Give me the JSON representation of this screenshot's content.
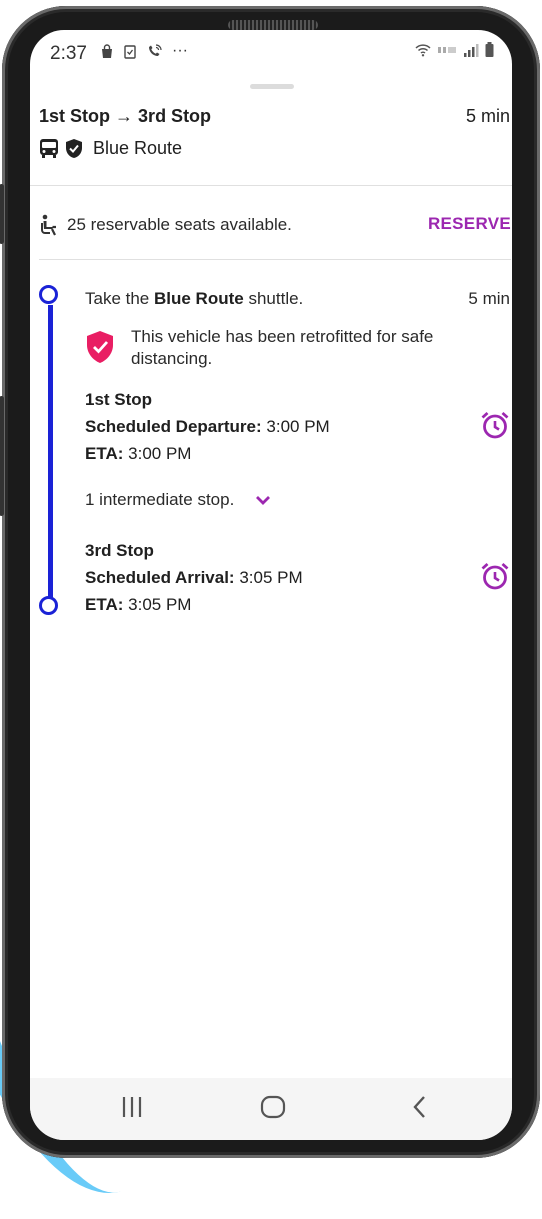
{
  "status_bar": {
    "time": "2:37",
    "more": "···"
  },
  "trip": {
    "from": "1st Stop",
    "arrow": "→",
    "to": "3rd Stop",
    "duration": "5 min",
    "route_name": "Blue Route"
  },
  "seats": {
    "text": "25 reservable seats available.",
    "reserve_label": "RESERVE"
  },
  "leg": {
    "take_prefix": "Take the",
    "route_name": "Blue Route",
    "take_suffix": "shuttle.",
    "duration": "5 min",
    "retrofit_text": "This vehicle has been retrofitted for safe distancing."
  },
  "departure": {
    "stop_name": "1st Stop",
    "scheduled_label": "Scheduled Departure:",
    "scheduled_value": "3:00 PM",
    "eta_label": "ETA:",
    "eta_value": "3:00 PM"
  },
  "intermediate": {
    "text": "1 intermediate stop."
  },
  "arrival": {
    "stop_name": "3rd Stop",
    "scheduled_label": "Scheduled Arrival:",
    "scheduled_value": "3:05 PM",
    "eta_label": "ETA:",
    "eta_value": "3:05 PM"
  },
  "colors": {
    "accent": "#9c27b0",
    "timeline": "#1a22d6",
    "shield": "#e91e63"
  },
  "icons": {
    "bus": "bus-icon",
    "verified": "verified-shield-icon",
    "accessible": "accessible-seat-icon",
    "safety": "safety-shield-icon",
    "alarm": "alarm-clock-icon",
    "expand": "chevron-down-icon"
  }
}
